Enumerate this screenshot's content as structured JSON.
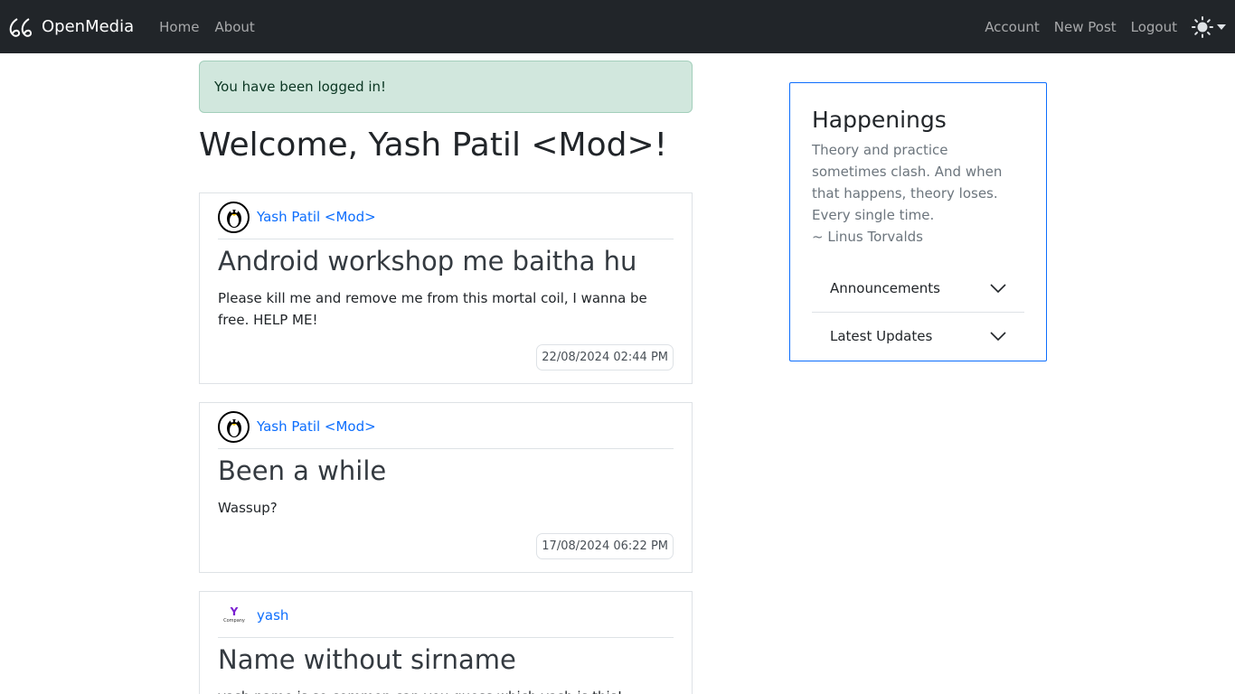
{
  "navbar": {
    "brand": "OpenMedia",
    "left_links": [
      "Home",
      "About"
    ],
    "right_links": [
      "Account",
      "New Post",
      "Logout"
    ]
  },
  "alert": {
    "text": "You have been logged in!"
  },
  "welcome": "Welcome, Yash Patil <Mod>!",
  "posts": [
    {
      "author": "Yash Patil <Mod>",
      "title": "Android workshop me baitha hu",
      "body": "Please kill me and remove me from this mortal coil, I wanna be free. HELP ME!",
      "timestamp": "22/08/2024 02:44 PM"
    },
    {
      "author": "Yash Patil <Mod>",
      "title": "Been a while",
      "body": "Wassup?",
      "timestamp": "17/08/2024 06:22 PM"
    },
    {
      "author": "yash",
      "title": "Name without sirname",
      "body": "yash name is so common can you guess which yash is this!",
      "avatar_text": "Y",
      "avatar_subtext": "Company"
    }
  ],
  "sidebar": {
    "title": "Happenings",
    "quote": "Theory and practice sometimes clash. And when that happens, theory loses. Every single time.",
    "quote_author": "~ Linus Torvalds",
    "accordion": [
      "Announcements",
      "Latest Updates"
    ]
  },
  "colors": {
    "navbar_bg": "#212529",
    "link": "#0d6efd",
    "alert_bg": "#d1e7dd",
    "sidebar_border": "#0d6efd"
  }
}
